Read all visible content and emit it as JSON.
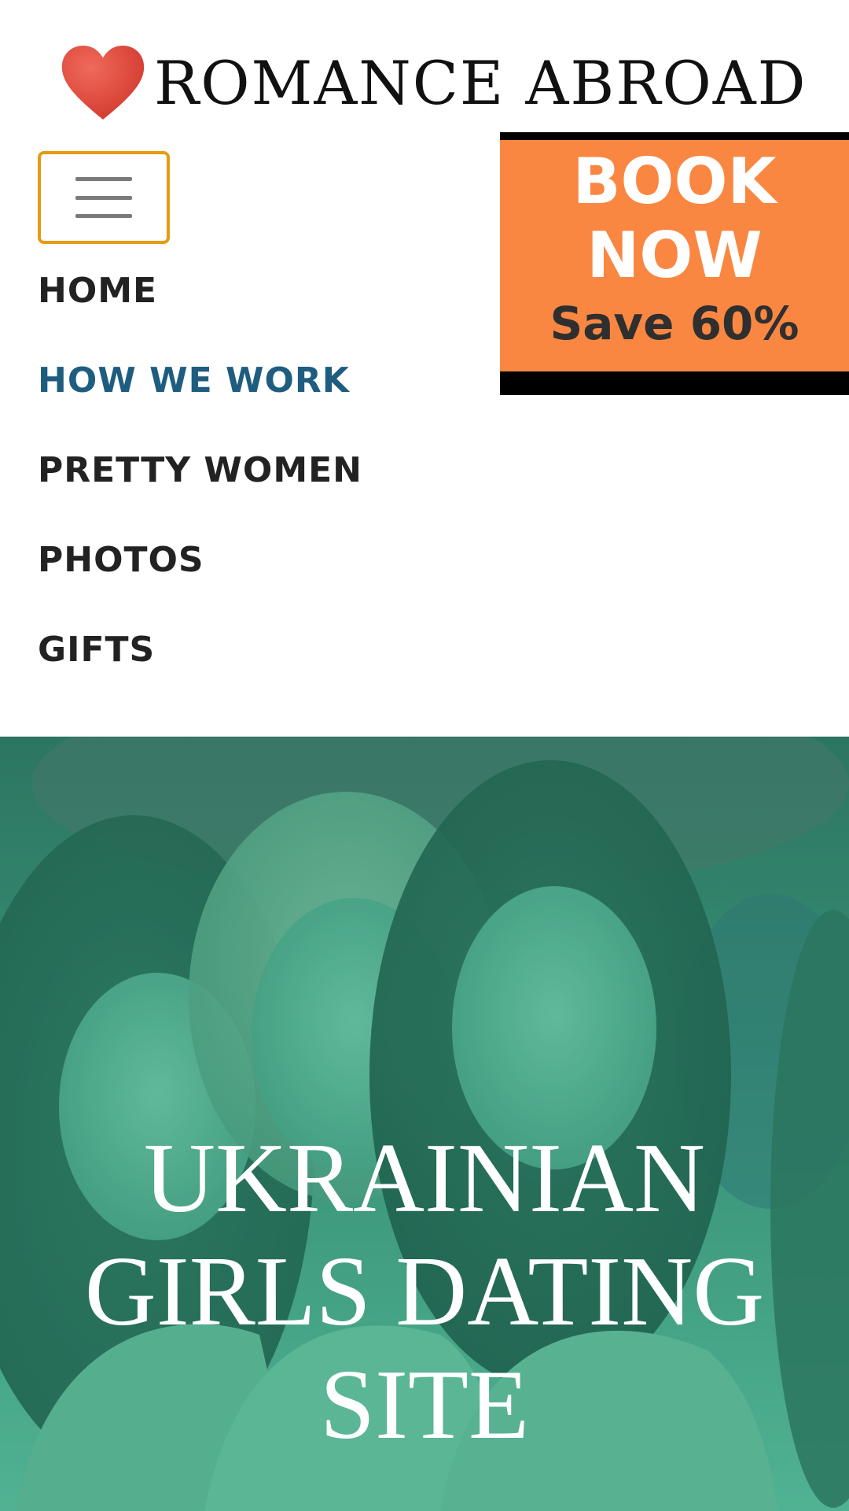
{
  "header": {
    "logo_text": "ROMANCE ABROAD",
    "logo_icon": "heart-icon",
    "logo_color": "#e0453a"
  },
  "menu_toggle": {
    "icon": "hamburger-menu-icon",
    "border_color": "#e69b12"
  },
  "nav": {
    "items": [
      {
        "label": "HOME",
        "active": false
      },
      {
        "label": "HOW WE WORK",
        "active": true
      },
      {
        "label": "PRETTY WOMEN",
        "active": false
      },
      {
        "label": "PHOTOS",
        "active": false
      },
      {
        "label": "GIFTS",
        "active": false
      }
    ],
    "active_color": "#1e5d80",
    "text_color": "#222222"
  },
  "promo": {
    "title_line1": "BOOK",
    "title_line2": "NOW",
    "subtitle": "Save 60%",
    "background_color": "#f98742"
  },
  "hero": {
    "title_line1": "UKRAINIAN",
    "title_line2": "GIRLS DATING",
    "title_line3": "SITE",
    "overlay_color": "#2f9a7c"
  }
}
